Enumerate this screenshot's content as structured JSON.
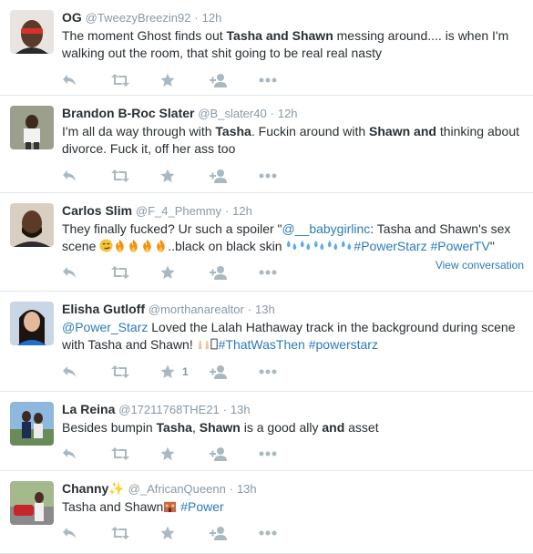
{
  "tweets": [
    {
      "name": "OG",
      "handle": "@TweezyBreezin92",
      "sep": "·",
      "time": "12h",
      "text": {
        "t1": "The moment Ghost finds out ",
        "b1": "Tasha and Shawn",
        "t2": " messing around.... is when I'm walking out the room, that shit going to be real real nasty"
      }
    },
    {
      "name": "Brandon B-Roc Slater",
      "handle": "@B_slater40",
      "sep": "·",
      "time": "12h",
      "text": {
        "t1": "I'm all da way through with ",
        "b1": "Tasha",
        "t2": ". Fuckin around with ",
        "b2": "Shawn and",
        "t3": " thinking about divorce. Fuck it, off her ass too"
      }
    },
    {
      "name": "Carlos Slim",
      "handle": "@F_4_Phemmy",
      "sep": "·",
      "time": "12h",
      "text": {
        "t1": "They finally fucked? Ur such a spoiler \"",
        "mention": "@__babygirlinc",
        "t2": ": Tasha and Shawn's sex scene ",
        "t3": "..black on black skin ",
        "tag1": "#PowerStarz",
        "tag2": "#PowerTV",
        "t4": "\""
      },
      "view_conversation": "View conversation"
    },
    {
      "name": "Elisha Gutloff",
      "handle": "@morthanarealtor",
      "sep": "·",
      "time": "13h",
      "text": {
        "mention": "@Power_Starz",
        "t1": " Loved the Lalah Hathaway track in the background during scene with Tasha and Shawn! ",
        "tag1": "#ThatWasThen",
        "tag2": "#powerstarz"
      },
      "favorite_count": "1"
    },
    {
      "name": "La Reina",
      "handle": "@17211768THE21",
      "sep": "·",
      "time": "13h",
      "text": {
        "t1": "Besides bumpin ",
        "b1": "Tasha",
        "t2": ", ",
        "b2": "Shawn",
        "t3": " is a good ally ",
        "b3": "and",
        "t4": " asset"
      }
    },
    {
      "name": "Channy✨",
      "handle": "@_AfricanQueenn",
      "sep": "·",
      "time": "13h",
      "text": {
        "t1": "Tasha and Shawn",
        "tag1": "#Power"
      }
    }
  ],
  "icons": [
    "reply-icon",
    "retweet-icon",
    "favorite-icon",
    "follow-icon",
    "more-icon"
  ],
  "colors": {
    "link": "#2b7bb9",
    "muted": "#8899a6",
    "icon": "#aab8c2",
    "divider": "#e1e8ed"
  }
}
